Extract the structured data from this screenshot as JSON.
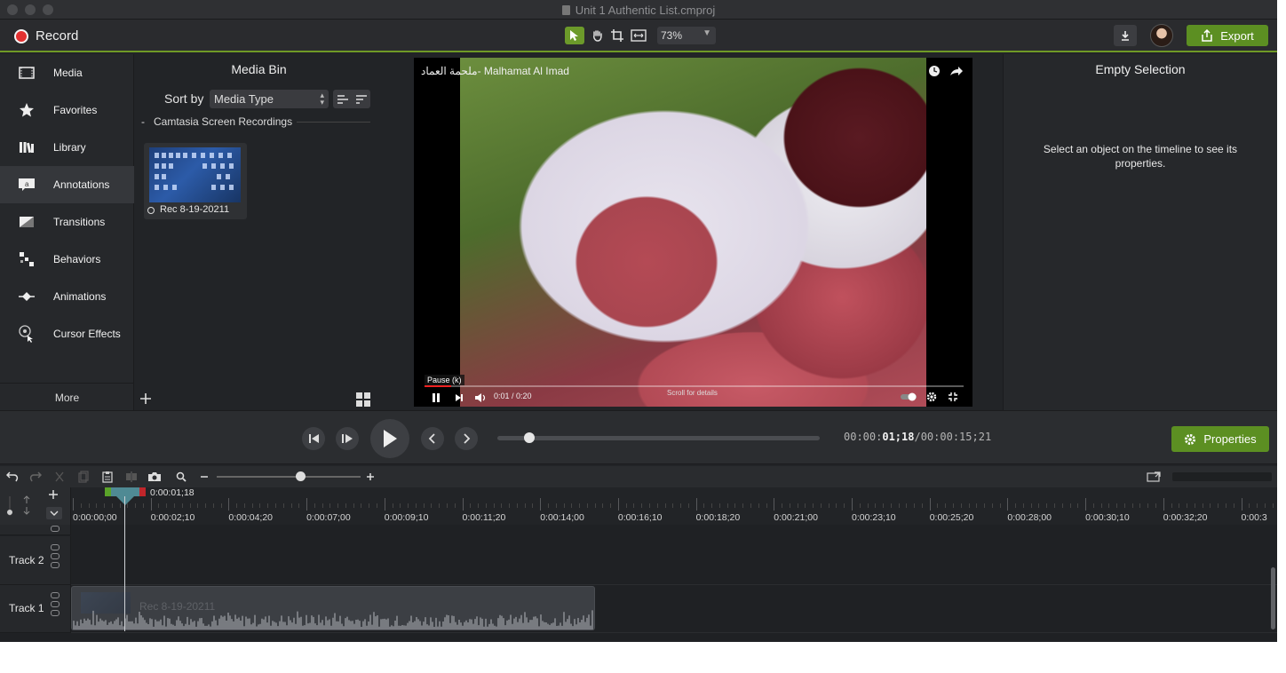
{
  "window": {
    "title": "Unit 1 Authentic List.cmproj"
  },
  "toolbar": {
    "record_label": "Record",
    "zoom_value": "73%",
    "export_label": "Export",
    "tools": [
      "pointer-icon",
      "hand-icon",
      "crop-icon",
      "fit-icon"
    ]
  },
  "nav": {
    "items": [
      {
        "label": "Media",
        "icon": "media-icon"
      },
      {
        "label": "Favorites",
        "icon": "star-icon"
      },
      {
        "label": "Library",
        "icon": "library-icon"
      },
      {
        "label": "Annotations",
        "icon": "annotations-icon"
      },
      {
        "label": "Transitions",
        "icon": "transitions-icon"
      },
      {
        "label": "Behaviors",
        "icon": "behaviors-icon"
      },
      {
        "label": "Animations",
        "icon": "animations-icon"
      },
      {
        "label": "Cursor Effects",
        "icon": "cursor-effects-icon"
      }
    ],
    "active_index": 3,
    "more_label": "More"
  },
  "media_bin": {
    "title": "Media Bin",
    "sort_label": "Sort by",
    "sort_value": "Media Type",
    "group_toggle": "-",
    "group_label": "Camtasia Screen Recordings",
    "items": [
      {
        "label": "Rec 8-19-20211"
      }
    ]
  },
  "video": {
    "title": "ملحمة العماد- Malhamat Al Imad",
    "tooltip": "Pause (k)",
    "time": "0:01 / 0:20",
    "scroll_hint": "Scroll for details",
    "progress": 0.05
  },
  "properties_panel": {
    "title": "Empty Selection",
    "message": "Select an object on the timeline to see its properties."
  },
  "playback": {
    "timecode_prefix": "00:00:",
    "timecode_current": "01;18",
    "timecode_suffix": "/00:00:15;21",
    "position": 0.1,
    "properties_label": "Properties"
  },
  "timeline": {
    "playhead_time": "0:00:01;18",
    "zoom_level": 0.58,
    "ruler_labels": [
      "0:00:00;00",
      "0:00:02;10",
      "0:00:04;20",
      "0:00:07;00",
      "0:00:09;10",
      "0:00:11;20",
      "0:00:14;00",
      "0:00:16;10",
      "0:00:18;20",
      "0:00:21;00",
      "0:00:23;10",
      "0:00:25;20",
      "0:00:28;00",
      "0:00:30;10",
      "0:00:32;20",
      "0:00:3"
    ],
    "tracks": [
      {
        "name": "Track 2"
      },
      {
        "name": "Track 1",
        "clip_label": "Rec 8-19-20211"
      }
    ]
  },
  "colors": {
    "accent_green": "#5c8f22",
    "record_red": "#e23131"
  }
}
